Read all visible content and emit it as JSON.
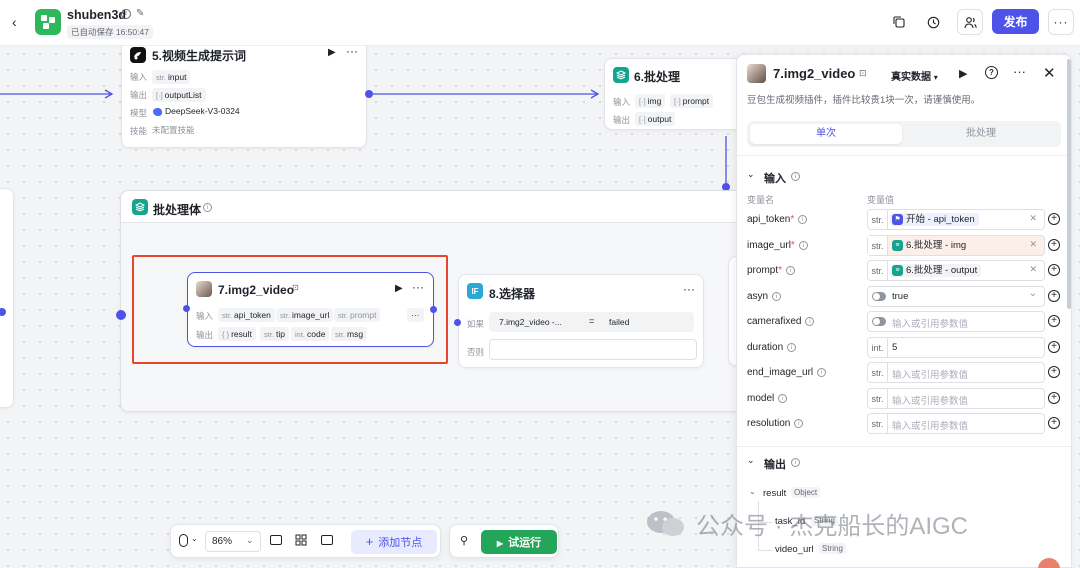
{
  "header": {
    "project_name": "shuben3d",
    "autosave": "已自动保存 16:50:47",
    "publish_label": "发布",
    "icons": [
      "back-icon",
      "app-logo-icon",
      "info-icon",
      "edit-icon",
      "copy-icon",
      "history-icon",
      "users-icon",
      "more-icon"
    ]
  },
  "nodes": {
    "n5": {
      "title": "5.视频生成提示词",
      "input_label": "输入",
      "input_value": "input",
      "output_label": "输出",
      "output_value": "outputList",
      "model_label": "模型",
      "model_value": "DeepSeek-V3-0324",
      "skill_label": "技能",
      "skill_value": "未配置技能"
    },
    "n6": {
      "title": "6.批处理",
      "input_label": "输入",
      "input_1": "img",
      "input_2": "prompt",
      "output_label": "输出",
      "output_value": "output"
    },
    "batch": {
      "title": "批处理体"
    },
    "n7": {
      "title": "7.img2_video",
      "input_label": "输入",
      "inputs": [
        "api_token",
        "image_url",
        "prompt"
      ],
      "output_label": "输出",
      "outputs": [
        "result",
        "tip",
        "code",
        "msg"
      ]
    },
    "n8": {
      "title": "8.选择器",
      "if_label": "如果",
      "cond_left": "7.img2_video -...",
      "cond_op": "=",
      "cond_right": "failed",
      "else_label": "否则"
    }
  },
  "type_labels": {
    "str": "str.",
    "int": "int.",
    "obj": "{ }",
    "arr": "[·]"
  },
  "toolbar": {
    "zoom": "86%",
    "add_node": "添加节点",
    "test_run": "试运行"
  },
  "panel": {
    "title": "7.img2_video",
    "data_mode": "真实数据",
    "description": "豆包生成视频插件，插件比较贵1块一次，请谨慎使用。",
    "tab_single": "单次",
    "tab_batch": "批处理",
    "input_section": "输入",
    "col_name": "变量名",
    "col_value": "变量值",
    "params": [
      {
        "name": "api_token",
        "required": true,
        "type": "str.",
        "kind": "ref",
        "ref_text": "开始 - api_token",
        "ref_color": "#4d53e8"
      },
      {
        "name": "image_url",
        "required": true,
        "type": "str.",
        "kind": "ref",
        "ref_text": "6.批处理 - img",
        "ref_color": "#16a58c"
      },
      {
        "name": "prompt",
        "required": true,
        "type": "str.",
        "kind": "ref",
        "ref_text": "6.批处理 - output",
        "ref_color": "#16a58c"
      },
      {
        "name": "asyn",
        "required": false,
        "type": "toggle",
        "kind": "select",
        "value": "true"
      },
      {
        "name": "camerafixed",
        "required": false,
        "type": "toggle",
        "kind": "placeholder",
        "value": "输入或引用参数值"
      },
      {
        "name": "duration",
        "required": false,
        "type": "int.",
        "kind": "value",
        "value": "5"
      },
      {
        "name": "end_image_url",
        "required": false,
        "type": "str.",
        "kind": "placeholder",
        "value": "输入或引用参数值"
      },
      {
        "name": "model",
        "required": false,
        "type": "str.",
        "kind": "placeholder",
        "value": "输入或引用参数值"
      },
      {
        "name": "resolution",
        "required": false,
        "type": "str.",
        "kind": "placeholder",
        "value": "输入或引用参数值"
      }
    ],
    "output_section": "输出",
    "outputs": [
      {
        "name": "result",
        "type": "Object"
      },
      {
        "name": "task_id",
        "type": "String"
      },
      {
        "name": "video_url",
        "type": "String"
      }
    ]
  },
  "watermark": "公众号 · 杰克船长的AIGC",
  "colors": {
    "accent": "#4d53e8",
    "highlight_border": "#e8452c",
    "success": "#23a55a",
    "teal": "#16a58c"
  }
}
